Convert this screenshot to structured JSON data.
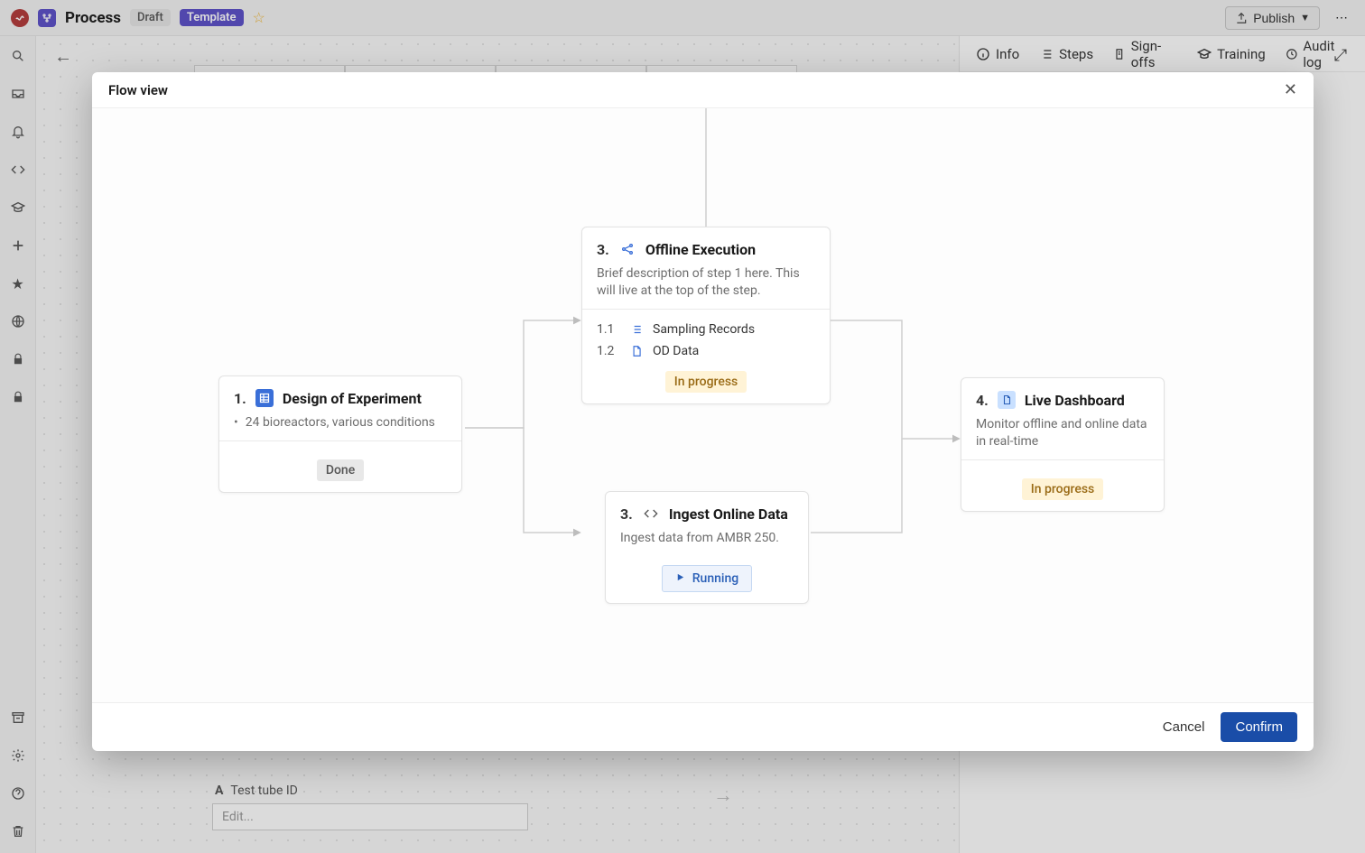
{
  "topbar": {
    "title": "Process",
    "draft_badge": "Draft",
    "template_badge": "Template",
    "publish_label": "Publish"
  },
  "right_tabs": {
    "info": "Info",
    "steps": "Steps",
    "signoffs": "Sign-offs",
    "training": "Training",
    "audit": "Audit log"
  },
  "background": {
    "field_label": "Test tube ID",
    "field_placeholder": "Edit..."
  },
  "modal": {
    "title": "Flow view",
    "cancel": "Cancel",
    "confirm": "Confirm"
  },
  "nodes": {
    "design": {
      "num": "1.",
      "title": "Design of Experiment",
      "desc": "24 bioreactors, various conditions",
      "status": "Done"
    },
    "offline": {
      "num": "3.",
      "title": "Offline Execution",
      "desc": "Brief description of step 1 here. This will live at the top of the step.",
      "sub1_num": "1.1",
      "sub1_label": "Sampling Records",
      "sub2_num": "1.2",
      "sub2_label": "OD Data",
      "status": "In progress"
    },
    "ingest": {
      "num": "3.",
      "title": "Ingest Online Data",
      "desc": "Ingest data from AMBR 250.",
      "status": "Running"
    },
    "dashboard": {
      "num": "4.",
      "title": "Live Dashboard",
      "desc": "Monitor offline and online data in real-time",
      "status": "In progress"
    }
  }
}
